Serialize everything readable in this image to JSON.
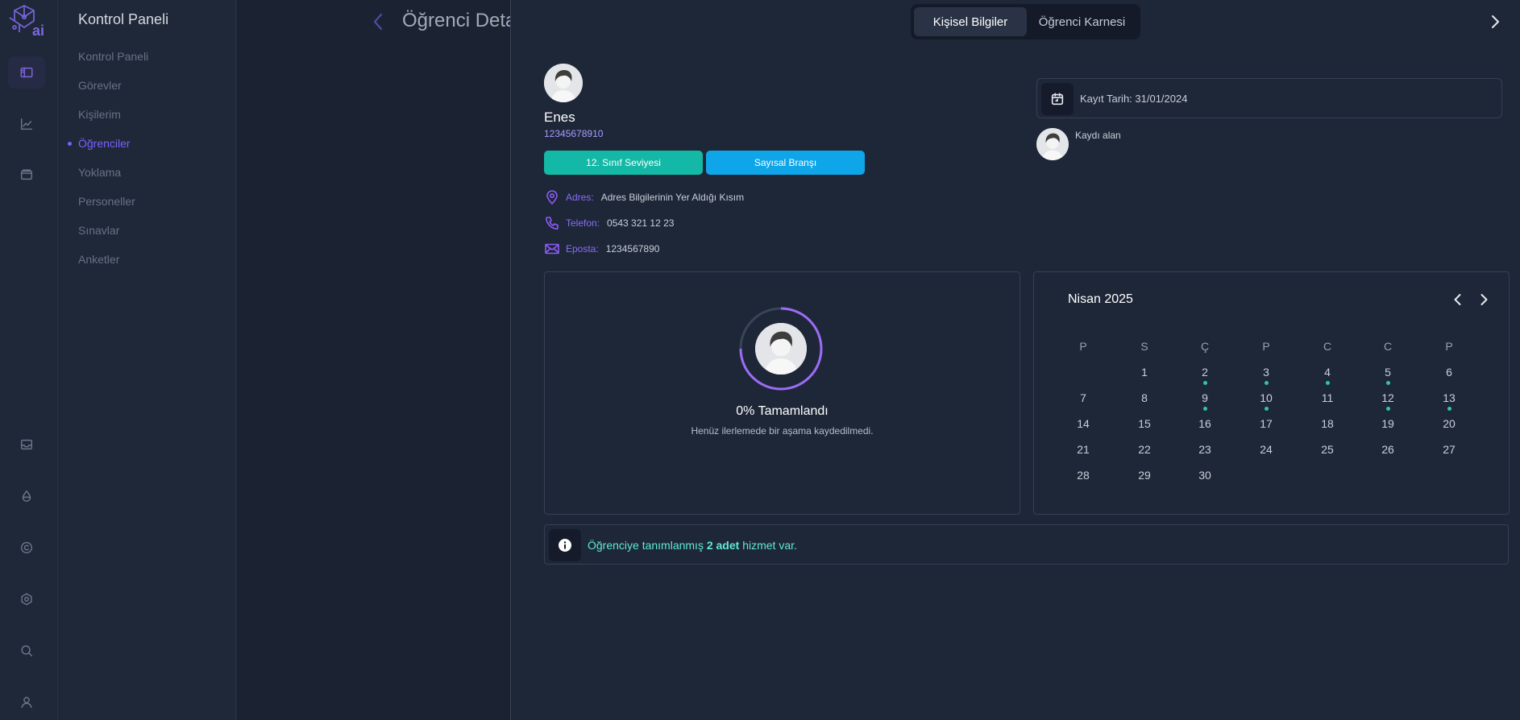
{
  "colors": {
    "accent": "#7b61ff",
    "grade_pill": "#14b8a6",
    "branch_pill": "#0ea5e9",
    "service_text": "#5eead4",
    "calendar_dot": "#2cc5a8"
  },
  "rail": {
    "logo_text": "ai",
    "icons": [
      "sidebar-panel-icon",
      "chart-icon",
      "folder-icon",
      "inbox-icon",
      "droplet-icon",
      "copyright-icon",
      "gear-icon",
      "search-icon",
      "user-icon"
    ]
  },
  "sidebar": {
    "title": "Kontrol Paneli",
    "items": [
      {
        "label": "Kontrol Paneli"
      },
      {
        "label": "Görevler"
      },
      {
        "label": "Kişilerim"
      },
      {
        "label": "Öğrenciler"
      },
      {
        "label": "Yoklama"
      },
      {
        "label": "Personeller"
      },
      {
        "label": "Sınavlar"
      },
      {
        "label": "Anketler"
      }
    ],
    "active_item": "Öğrenciler"
  },
  "background_page": {
    "title": "Öğrenci Detay"
  },
  "drawer": {
    "tabs": [
      {
        "label": "Kişisel Bilgiler"
      },
      {
        "label": "Öğrenci Karnesi"
      }
    ],
    "active_tab": "Kişisel Bilgiler"
  },
  "profile": {
    "name": "Enes",
    "id_number": "12345678910",
    "grade": "12. Sınıf Seviyesi",
    "branch": "Sayısal Branşı",
    "address_label": "Adres:",
    "address": "Adres Bilgilerinin Yer Aldığı Kısım",
    "phone_label": "Telefon:",
    "phone": "0543 321 12 23",
    "email_label": "Eposta:",
    "email": "1234567890"
  },
  "registration": {
    "date_text": "Kayıt Tarih: 31/01/2024",
    "registered_by_label": "Kaydı alan"
  },
  "progress": {
    "percent": 0,
    "title": "0% Tamamlandı",
    "subtitle": "Henüz ilerlemede bir aşama kaydedilmedi."
  },
  "calendar": {
    "month": "Nisan 2025",
    "weekdays": [
      "P",
      "S",
      "Ç",
      "P",
      "C",
      "C",
      "P"
    ],
    "days": [
      {
        "day": "1",
        "col": 1,
        "row": 0,
        "dot": false
      },
      {
        "day": "2",
        "col": 2,
        "row": 0,
        "dot": true
      },
      {
        "day": "3",
        "col": 3,
        "row": 0,
        "dot": true
      },
      {
        "day": "4",
        "col": 4,
        "row": 0,
        "dot": true
      },
      {
        "day": "5",
        "col": 5,
        "row": 0,
        "dot": true
      },
      {
        "day": "6",
        "col": 6,
        "row": 0,
        "dot": false
      },
      {
        "day": "7",
        "col": 0,
        "row": 1,
        "dot": false
      },
      {
        "day": "8",
        "col": 1,
        "row": 1,
        "dot": false
      },
      {
        "day": "9",
        "col": 2,
        "row": 1,
        "dot": true
      },
      {
        "day": "10",
        "col": 3,
        "row": 1,
        "dot": true
      },
      {
        "day": "11",
        "col": 4,
        "row": 1,
        "dot": false
      },
      {
        "day": "12",
        "col": 5,
        "row": 1,
        "dot": true
      },
      {
        "day": "13",
        "col": 6,
        "row": 1,
        "dot": true
      },
      {
        "day": "14",
        "col": 0,
        "row": 2,
        "dot": false
      },
      {
        "day": "15",
        "col": 1,
        "row": 2,
        "dot": false
      },
      {
        "day": "16",
        "col": 2,
        "row": 2,
        "dot": false
      },
      {
        "day": "17",
        "col": 3,
        "row": 2,
        "dot": false
      },
      {
        "day": "18",
        "col": 4,
        "row": 2,
        "dot": false
      },
      {
        "day": "19",
        "col": 5,
        "row": 2,
        "dot": false
      },
      {
        "day": "20",
        "col": 6,
        "row": 2,
        "dot": false
      },
      {
        "day": "21",
        "col": 0,
        "row": 3,
        "dot": false
      },
      {
        "day": "22",
        "col": 1,
        "row": 3,
        "dot": false
      },
      {
        "day": "23",
        "col": 2,
        "row": 3,
        "dot": false
      },
      {
        "day": "24",
        "col": 3,
        "row": 3,
        "dot": false
      },
      {
        "day": "25",
        "col": 4,
        "row": 3,
        "dot": false
      },
      {
        "day": "26",
        "col": 5,
        "row": 3,
        "dot": false
      },
      {
        "day": "27",
        "col": 6,
        "row": 3,
        "dot": false
      },
      {
        "day": "28",
        "col": 0,
        "row": 4,
        "dot": false
      },
      {
        "day": "29",
        "col": 1,
        "row": 4,
        "dot": false
      },
      {
        "day": "30",
        "col": 2,
        "row": 4,
        "dot": false
      }
    ]
  },
  "services": {
    "text_before": "Öğrenciye tanımlanmış ",
    "count_text": "2 adet",
    "text_after": " hizmet var."
  }
}
